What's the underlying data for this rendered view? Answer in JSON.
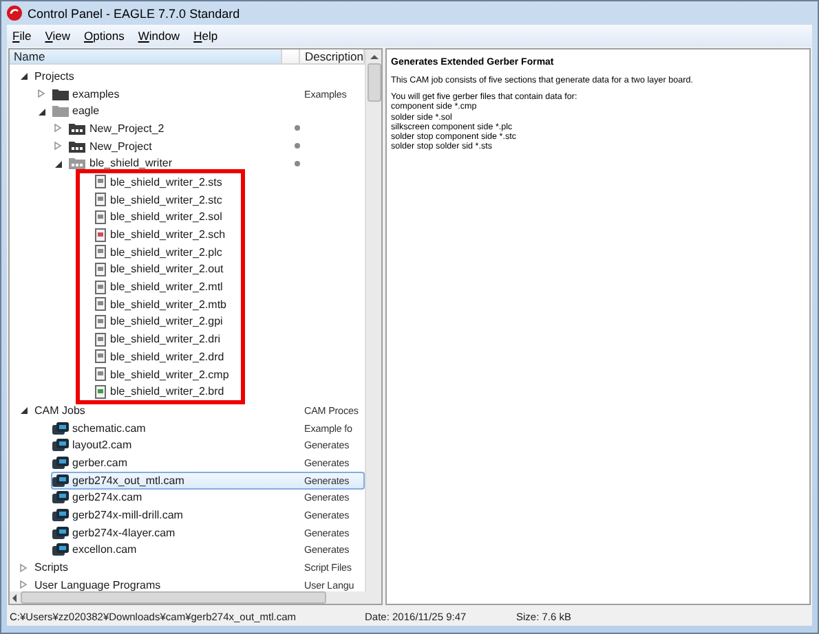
{
  "window": {
    "title": "Control Panel - EAGLE 7.7.0 Standard"
  },
  "menu": [
    {
      "label": "File"
    },
    {
      "label": "View"
    },
    {
      "label": "Options"
    },
    {
      "label": "Window"
    },
    {
      "label": "Help"
    }
  ],
  "tree": {
    "columns": [
      "Name",
      "Description"
    ],
    "items": [
      {
        "label": "Projects",
        "expanded": true,
        "selected": false,
        "children": [
          {
            "label": "examples",
            "kind": "folder",
            "expanded": false,
            "selected": false,
            "description": "Examples"
          },
          {
            "label": "eagle",
            "kind": "folder",
            "expanded": true,
            "selected": false,
            "children": [
              {
                "label": "New_Project_2",
                "kind": "project",
                "expanded": false,
                "selected": false,
                "dot": true
              },
              {
                "label": "New_Project",
                "kind": "project",
                "expanded": false,
                "selected": false,
                "dot": true
              },
              {
                "label": "ble_shield_writer",
                "kind": "project",
                "expanded": true,
                "selected": false,
                "dot": true,
                "framed": true,
                "children": [
                  {
                    "label": "ble_shield_writer_2.sts",
                    "kind": "file",
                    "selected": false
                  },
                  {
                    "label": "ble_shield_writer_2.stc",
                    "kind": "file",
                    "selected": false
                  },
                  {
                    "label": "ble_shield_writer_2.sol",
                    "kind": "file",
                    "selected": false
                  },
                  {
                    "label": "ble_shield_writer_2.sch",
                    "kind": "schematic",
                    "selected": false
                  },
                  {
                    "label": "ble_shield_writer_2.plc",
                    "kind": "file",
                    "selected": false
                  },
                  {
                    "label": "ble_shield_writer_2.out",
                    "kind": "file",
                    "selected": false
                  },
                  {
                    "label": "ble_shield_writer_2.mtl",
                    "kind": "file",
                    "selected": false
                  },
                  {
                    "label": "ble_shield_writer_2.mtb",
                    "kind": "file",
                    "selected": false
                  },
                  {
                    "label": "ble_shield_writer_2.gpi",
                    "kind": "file",
                    "selected": false
                  },
                  {
                    "label": "ble_shield_writer_2.dri",
                    "kind": "file",
                    "selected": false
                  },
                  {
                    "label": "ble_shield_writer_2.drd",
                    "kind": "file",
                    "selected": false
                  },
                  {
                    "label": "ble_shield_writer_2.cmp",
                    "kind": "file",
                    "selected": false
                  },
                  {
                    "label": "ble_shield_writer_2.brd",
                    "kind": "board",
                    "selected": false
                  }
                ]
              }
            ]
          }
        ]
      },
      {
        "label": "CAM Jobs",
        "expanded": true,
        "selected": false,
        "description": "CAM Proces",
        "children": [
          {
            "label": "schematic.cam",
            "kind": "cam",
            "selected": false,
            "description": "Example fo"
          },
          {
            "label": "layout2.cam",
            "kind": "cam",
            "selected": false,
            "description": "Generates"
          },
          {
            "label": "gerber.cam",
            "kind": "cam",
            "selected": false,
            "description": "Generates"
          },
          {
            "label": "gerb274x_out_mtl.cam",
            "kind": "cam",
            "selected": true,
            "description": "Generates"
          },
          {
            "label": "gerb274x.cam",
            "kind": "cam",
            "selected": false,
            "description": "Generates"
          },
          {
            "label": "gerb274x-mill-drill.cam",
            "kind": "cam",
            "selected": false,
            "description": "Generates"
          },
          {
            "label": "gerb274x-4layer.cam",
            "kind": "cam",
            "selected": false,
            "description": "Generates"
          },
          {
            "label": "excellon.cam",
            "kind": "cam",
            "selected": false,
            "description": "Generates"
          }
        ]
      },
      {
        "label": "Scripts",
        "expanded": false,
        "selected": false,
        "description": "Script Files"
      },
      {
        "label": "User Language Programs",
        "expanded": false,
        "selected": false,
        "description": "User Langu"
      }
    ]
  },
  "details": {
    "heading": "Generates Extended Gerber Format",
    "intro": "This CAM job consists of five sections that generate data for a two layer board.",
    "lines": [
      "You will get five gerber files that contain data for:",
      "component side *.cmp",
      "solder side *.sol",
      "silkscreen component side *.plc",
      "solder stop component side *.stc",
      "solder stop solder sid *.sts"
    ]
  },
  "status_bar": {
    "path": "C:¥Users¥zz020382¥Downloads¥cam¥gerb274x_out_mtl.cam",
    "date": "Date: 2016/11/25 9:47",
    "size": "Size: 7.6 kB"
  }
}
